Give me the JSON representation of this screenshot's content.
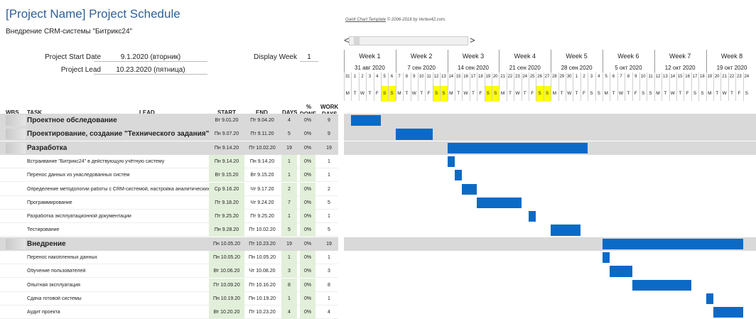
{
  "header": {
    "title": "[Project Name] Project Schedule",
    "subtitle": "Внедрение CRM-системы \"Битрикс24\"",
    "template_credit_link": "Gantt Chart Template",
    "template_credit_rest": "© 2006-2018 by Vertex42.com."
  },
  "meta": {
    "start_label": "Project Start Date",
    "start_value": "9.1.2020 (вторник)",
    "lead_label": "Project Lead",
    "lead_value": "10.23.2020 (пятница)",
    "display_week_label": "Display Week",
    "display_week_value": "1"
  },
  "scroll": {
    "left": "<",
    "right": ">"
  },
  "columns": {
    "wbs": "WBS",
    "task": "TASK",
    "lead": "LEAD",
    "start": "START",
    "end": "END",
    "days": "DAYS",
    "done_top": "%",
    "done_bottom": "DONE",
    "work_top": "WORK",
    "work_bottom": "DAYS"
  },
  "weeks": [
    {
      "label": "Week 1",
      "date": "31 авг 2020"
    },
    {
      "label": "Week 2",
      "date": "7 сен 2020"
    },
    {
      "label": "Week 3",
      "date": "14 сен 2020"
    },
    {
      "label": "Week 4",
      "date": "21 сен 2020"
    },
    {
      "label": "Week 5",
      "date": "28 сен 2020"
    },
    {
      "label": "Week 6",
      "date": "5 окт 2020"
    },
    {
      "label": "Week 7",
      "date": "12 окт 2020"
    },
    {
      "label": "Week 8",
      "date": "19 окт 2020"
    }
  ],
  "day_numbers": [
    "31",
    "1",
    "2",
    "3",
    "4",
    "5",
    "6",
    "7",
    "8",
    "9",
    "10",
    "11",
    "12",
    "13",
    "14",
    "15",
    "16",
    "17",
    "18",
    "19",
    "20",
    "21",
    "22",
    "23",
    "24",
    "25",
    "26",
    "27",
    "28",
    "29",
    "30",
    "1",
    "2",
    "3",
    "4",
    "5",
    "6",
    "7",
    "8",
    "9",
    "10",
    "11",
    "12",
    "13",
    "14",
    "15",
    "16",
    "17",
    "18",
    "19",
    "20",
    "21",
    "22",
    "23",
    "24"
  ],
  "day_letters": [
    "M",
    "T",
    "W",
    "T",
    "F",
    "S",
    "S"
  ],
  "weekend_highlight_weeks": 4,
  "rows": [
    {
      "type": "phase",
      "task": "Проектное обследование",
      "start": "Вт 9.01.20",
      "end": "Пт 9.04.20",
      "days": "4",
      "done": "0%",
      "work": "9",
      "bar_start": 1,
      "bar_len": 4
    },
    {
      "type": "phase",
      "task": "Проектирование, создание \"Технического задания\"",
      "start": "Пн 9.07.20",
      "end": "Пт 9.11.20",
      "days": "5",
      "done": "0%",
      "work": "9",
      "bar_start": 7,
      "bar_len": 5
    },
    {
      "type": "phase",
      "task": "Разработка",
      "start": "Пн 9.14.20",
      "end": "Пт 10.02.20",
      "days": "19",
      "done": "0%",
      "work": "19",
      "bar_start": 14,
      "bar_len": 19
    },
    {
      "type": "sub",
      "task": "Встраивание \"Битрикс24\" в действующую учётную систему",
      "start": "Пн 9.14.20",
      "end": "Пн 9.14.20",
      "days": "1",
      "done": "0%",
      "work": "1",
      "bar_start": 14,
      "bar_len": 1
    },
    {
      "type": "sub",
      "task": "Перенос данных из унаследованных систем",
      "start": "Вт 9.15.20",
      "end": "Вт 9.15.20",
      "days": "1",
      "done": "0%",
      "work": "1",
      "bar_start": 15,
      "bar_len": 1
    },
    {
      "type": "sub",
      "task": "Определение методологии работы с CRM-системой, настройка аналитических с",
      "start": "Ср 9.16.20",
      "end": "Чт 9.17.20",
      "days": "2",
      "done": "0%",
      "work": "2",
      "bar_start": 16,
      "bar_len": 2
    },
    {
      "type": "sub",
      "task": "Программирование",
      "start": "Пт 9.18.20",
      "end": "Чт 9.24.20",
      "days": "7",
      "done": "0%",
      "work": "5",
      "bar_start": 18,
      "bar_len": 6
    },
    {
      "type": "sub",
      "task": "Разработка эксплуатационной документации",
      "start": "Пт 9.25.20",
      "end": "Пт 9.25.20",
      "days": "1",
      "done": "0%",
      "work": "1",
      "bar_start": 25,
      "bar_len": 1
    },
    {
      "type": "sub",
      "task": "Тестирование",
      "start": "Пн 9.28.20",
      "end": "Пт 10.02.20",
      "days": "5",
      "done": "0%",
      "work": "5",
      "bar_start": 28,
      "bar_len": 4
    },
    {
      "type": "phase",
      "task": "Внедрение",
      "start": "Пн 10.05.20",
      "end": "Пт 10.23.20",
      "days": "19",
      "done": "0%",
      "work": "19",
      "bar_start": 35,
      "bar_len": 19
    },
    {
      "type": "sub",
      "task": "Перенос накопленных данных",
      "start": "Пн 10.05.20",
      "end": "Пн 10.05.20",
      "days": "1",
      "done": "0%",
      "work": "1",
      "bar_start": 35,
      "bar_len": 1
    },
    {
      "type": "sub",
      "task": "Обучение пользователей",
      "start": "Вт 10.06.20",
      "end": "Чт 10.08.20",
      "days": "3",
      "done": "0%",
      "work": "3",
      "bar_start": 36,
      "bar_len": 3
    },
    {
      "type": "sub",
      "task": "Опытная эксплуатация",
      "start": "Пт 10.09.20",
      "end": "Пт 10.16.20",
      "days": "8",
      "done": "0%",
      "work": "8",
      "bar_start": 39,
      "bar_len": 8
    },
    {
      "type": "sub",
      "task": "Сдача готовой системы",
      "start": "Пн 10.19.20",
      "end": "Пн 10.19.20",
      "days": "1",
      "done": "0%",
      "work": "1",
      "bar_start": 49,
      "bar_len": 1
    },
    {
      "type": "sub",
      "task": "Аудит проекта",
      "start": "Вт 10.20.20",
      "end": "Пт 10.23.20",
      "days": "4",
      "done": "0%",
      "work": "4",
      "bar_start": 50,
      "bar_len": 4
    }
  ],
  "colors": {
    "bar": "#0b6ac6",
    "phase_band": "#d9d9d9",
    "weekend": "#ffff00",
    "input_cell": "#e2efda",
    "title": "#2f5f95"
  }
}
